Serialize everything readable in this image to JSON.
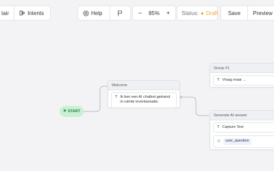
{
  "toolbar": {
    "left_partial_label": "tair",
    "intents_label": "Intents",
    "help_label": "Help",
    "zoom_value": "85%",
    "zoom_minus": "−",
    "zoom_plus": "+",
    "status_label": "Status:",
    "status_value": "Draft",
    "save_label": "Save",
    "preview_label": "Preview"
  },
  "flow": {
    "start_label": "START",
    "welcome": {
      "title": "Welcome",
      "text": "Ik ben een AI chatbot getraind in ruimte inventarisatie."
    },
    "group1": {
      "title": "Group #1",
      "text": "Vraag maar ..."
    },
    "generate": {
      "title": "Generate AI answer",
      "capture_text": "Capture Text",
      "variable": "user_question"
    }
  },
  "colors": {
    "status_draft": "#f0a23a",
    "start_bg": "#c9f0d3",
    "start_text": "#2e7d4a",
    "canvas_bg": "#f3f3f5"
  },
  "icons": {
    "intents": "intents-icon",
    "help": "help-icon",
    "flag": "flag-icon",
    "text": "text-icon",
    "variable": "variable-icon"
  }
}
